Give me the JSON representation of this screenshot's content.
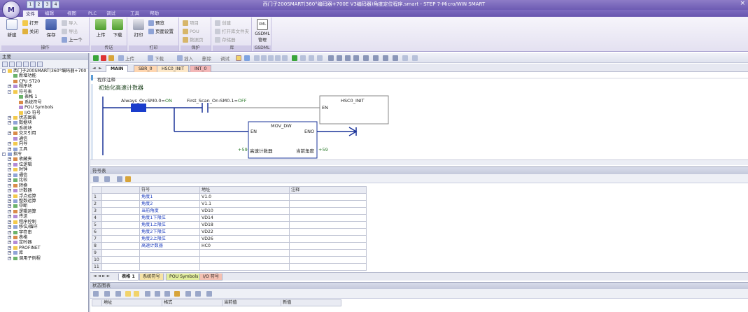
{
  "window": {
    "title": "西门子200SMART(360°编码器+700E V3编码器)角度定位程序.smart - STEP 7-Micro/WIN SMART",
    "logo_text": "M",
    "qat": [
      "1",
      "2",
      "3",
      "4"
    ],
    "close_glyph": "×"
  },
  "ribbon_tabs": [
    {
      "label": "文件",
      "active": true
    },
    {
      "label": "编辑"
    },
    {
      "label": "视图"
    },
    {
      "label": "PLC"
    },
    {
      "label": "调试"
    },
    {
      "label": "工具"
    },
    {
      "label": "帮助"
    }
  ],
  "ribbon": {
    "groups": {
      "operation": {
        "caption": "操作",
        "new": "新建",
        "open": "打开",
        "close": "关闭",
        "save": "保存",
        "import": "导入",
        "export": "导出",
        "prev": "上一个"
      },
      "transfer": {
        "caption": "传送",
        "upload": "上传",
        "download": "下载"
      },
      "print": {
        "caption": "打印",
        "print": "打印",
        "preview": "预览",
        "page_setup": "页面设置"
      },
      "protect": {
        "caption": "保护",
        "project": "项目",
        "pou": "POU",
        "data_page": "数据页"
      },
      "library": {
        "caption": "库",
        "create": "创建",
        "open_folder": "打开库文件夹",
        "lib_mem": "存储器"
      },
      "gsdml": {
        "caption": "GSDML",
        "manage": "GSDML\n管理",
        "xml": "XML"
      }
    }
  },
  "project_tree": {
    "header": "主要",
    "items": [
      {
        "label": "西门子200SMART(360°编码器+700",
        "level": 0,
        "exp": "-"
      },
      {
        "label": "新增功能",
        "level": 1
      },
      {
        "label": "CPU ST20",
        "level": 1
      },
      {
        "label": "程序块",
        "level": 1,
        "exp": "+"
      },
      {
        "label": "符号表",
        "level": 1,
        "exp": "-"
      },
      {
        "label": "表格 1",
        "level": 2
      },
      {
        "label": "系统符号",
        "level": 2
      },
      {
        "label": "POU Symbols",
        "level": 2
      },
      {
        "label": "I/O 符号",
        "level": 2
      },
      {
        "label": "状态图表",
        "level": 1,
        "exp": "+"
      },
      {
        "label": "数据块",
        "level": 1,
        "exp": "+"
      },
      {
        "label": "系统块",
        "level": 1
      },
      {
        "label": "交叉引用",
        "level": 1,
        "exp": "+"
      },
      {
        "label": "通信",
        "level": 1
      },
      {
        "label": "向导",
        "level": 1,
        "exp": "+"
      },
      {
        "label": "工具",
        "level": 1,
        "exp": "+"
      },
      {
        "label": "指令",
        "level": 0,
        "exp": "-"
      },
      {
        "label": "收藏夹",
        "level": 1,
        "exp": "+"
      },
      {
        "label": "位逻辑",
        "level": 1,
        "exp": "+"
      },
      {
        "label": "时钟",
        "level": 1,
        "exp": "+"
      },
      {
        "label": "通信",
        "level": 1,
        "exp": "+"
      },
      {
        "label": "比较",
        "level": 1,
        "exp": "+"
      },
      {
        "label": "转换",
        "level": 1,
        "exp": "+"
      },
      {
        "label": "计数器",
        "level": 1,
        "exp": "+"
      },
      {
        "label": "浮点运算",
        "level": 1,
        "exp": "+"
      },
      {
        "label": "整数运算",
        "level": 1,
        "exp": "+"
      },
      {
        "label": "中断",
        "level": 1,
        "exp": "+"
      },
      {
        "label": "逻辑运算",
        "level": 1,
        "exp": "+"
      },
      {
        "label": "传送",
        "level": 1,
        "exp": "+"
      },
      {
        "label": "程序控制",
        "level": 1,
        "exp": "+"
      },
      {
        "label": "移位/循环",
        "level": 1,
        "exp": "+"
      },
      {
        "label": "字符串",
        "level": 1,
        "exp": "+"
      },
      {
        "label": "表格",
        "level": 1,
        "exp": "+"
      },
      {
        "label": "定时器",
        "level": 1,
        "exp": "+"
      },
      {
        "label": "PROFINET",
        "level": 1,
        "exp": "+"
      },
      {
        "label": "库",
        "level": 1,
        "exp": "+"
      },
      {
        "label": "调用子例程",
        "level": 1,
        "exp": "+"
      }
    ]
  },
  "editor": {
    "toolbar": {
      "upload": "上传",
      "download": "下载",
      "insert": "插入",
      "delete": "删除",
      "debug": "调试"
    },
    "tabs": [
      {
        "label": "MAIN",
        "style": "main"
      },
      {
        "label": "SBR_0",
        "style": "sbr"
      },
      {
        "label": "HSC0_INIT",
        "style": "hsc"
      },
      {
        "label": "INT_0",
        "style": "intt"
      }
    ],
    "nav_prev": "◄",
    "nav_next": "►",
    "comment": "程序注释",
    "network_number": "1",
    "network_title": "初始化高速计数器",
    "ladder": {
      "contact1_label": "Always_On:SM0.0",
      "contact1_value": "ON",
      "contact2_label": "First_Scan_On:SM0.1",
      "contact2_value": "OFF",
      "box1_name": "HSC0_INIT",
      "box1_en": "EN",
      "box2_name": "MOV_DW",
      "box2_en": "EN",
      "box2_eno": "ENO",
      "in_value": "+59",
      "in_symbol": "高速计数器",
      "out_symbol": "当前角度",
      "out_value": "+59",
      "in_pin": "IN",
      "out_pin": "OUT"
    }
  },
  "symbol_table": {
    "header": "符号表",
    "columns": [
      "",
      "",
      "符号",
      "地址",
      "注释"
    ],
    "rows": [
      {
        "n": "1",
        "sym": "角度1",
        "addr": "V1.0",
        "cmt": ""
      },
      {
        "n": "2",
        "sym": "角度2",
        "addr": "V1.1",
        "cmt": ""
      },
      {
        "n": "3",
        "sym": "当前角度",
        "addr": "VD10",
        "cmt": ""
      },
      {
        "n": "4",
        "sym": "角度1下限位",
        "addr": "VD14",
        "cmt": ""
      },
      {
        "n": "5",
        "sym": "角度1上限位",
        "addr": "VD18",
        "cmt": ""
      },
      {
        "n": "6",
        "sym": "角度2下限位",
        "addr": "VD22",
        "cmt": ""
      },
      {
        "n": "7",
        "sym": "角度2上限位",
        "addr": "VD26",
        "cmt": ""
      },
      {
        "n": "8",
        "sym": "高速计数器",
        "addr": "HC0",
        "cmt": ""
      },
      {
        "n": "9",
        "sym": "",
        "addr": "",
        "cmt": ""
      },
      {
        "n": "10",
        "sym": "",
        "addr": "",
        "cmt": ""
      },
      {
        "n": "11",
        "sym": "",
        "addr": "",
        "cmt": ""
      }
    ],
    "bottom_nav": "◄ ◄ ► ►",
    "bottom_tabs": [
      {
        "label": "表格 1",
        "style": "t1"
      },
      {
        "label": "系统符号",
        "style": "t2"
      },
      {
        "label": "POU Symbols",
        "style": "t3"
      },
      {
        "label": "I/O 符号",
        "style": "t4"
      }
    ]
  },
  "status_chart": {
    "header": "状态图表",
    "columns": [
      "",
      "地址",
      "格式",
      "当前值",
      "新值"
    ]
  }
}
